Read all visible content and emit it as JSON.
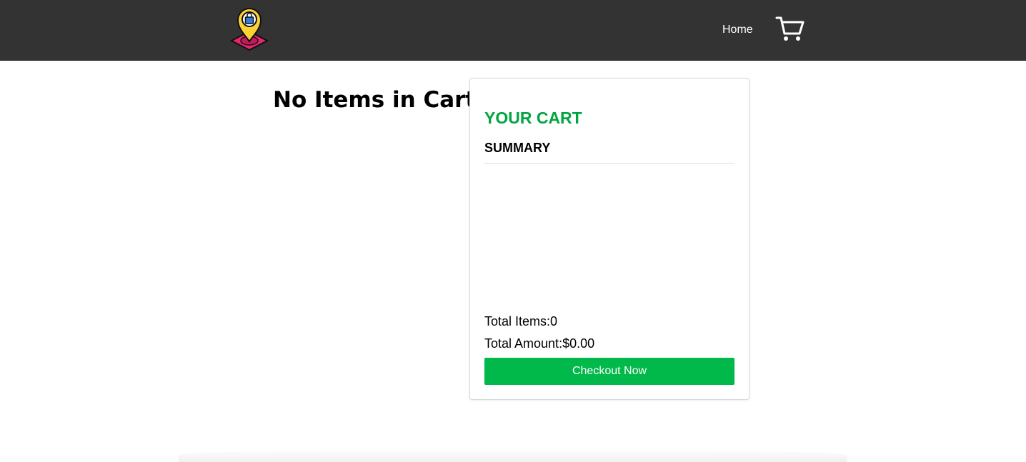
{
  "navbar": {
    "logo_icon": "map-pin-shopping-bag-logo",
    "home_label": "Home",
    "cart_icon": "shopping-cart-icon",
    "background": "#333333"
  },
  "main": {
    "empty_message": "No Items in Cart"
  },
  "cart": {
    "heading": "YOUR CART",
    "heading_color": "#00a540",
    "summary_label": "SUMMARY",
    "total_items_label": "Total Items:",
    "total_items_value": "0",
    "total_amount_label": "Total Amount:",
    "total_amount_value": "$0.00",
    "checkout_label": "Checkout Now",
    "checkout_color": "#00b94a"
  }
}
